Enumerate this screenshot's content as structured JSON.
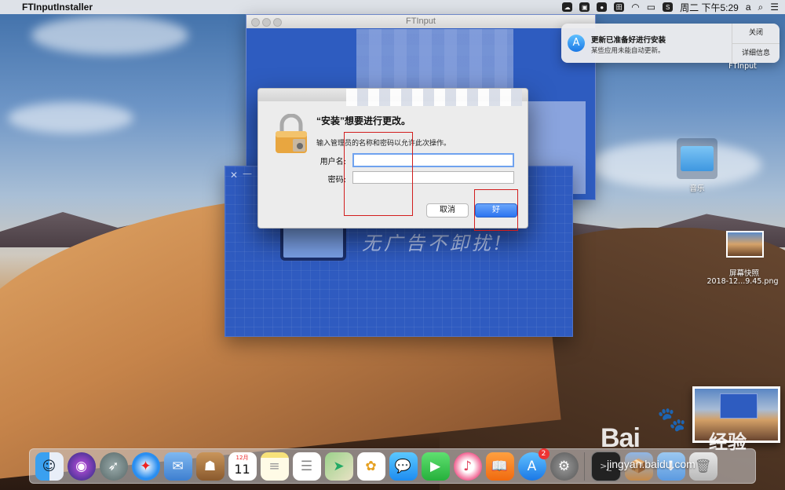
{
  "menubar": {
    "app_name": "FTInputInstaller",
    "clock": "周二 下午5:29",
    "input_source": "a"
  },
  "ftinput_window": {
    "title": "FTInput"
  },
  "blue_window": {
    "slogan": "无广告不卸扰!"
  },
  "auth_dialog": {
    "title": "“安装”想要进行更改。",
    "message": "输入管理员的名称和密码以允许此次操作。",
    "username_label": "用户名:",
    "username_value": "",
    "password_label": "密码:",
    "password_value": "",
    "cancel_label": "取消",
    "ok_label": "好"
  },
  "notification": {
    "title": "更新已准备好进行安装",
    "body": "某些应用未能自动更新。",
    "close_label": "关闭",
    "details_label": "详细信息"
  },
  "desktop": {
    "ftinput_label": "FTInput",
    "music_folder_label": "音乐",
    "screenshot_label_line1": "屏幕快照",
    "screenshot_label_line2": "2018-12...9.45.png"
  },
  "dock": {
    "calendar_month": "12月",
    "calendar_day": "11",
    "appstore_badge": "2",
    "items": [
      "finder",
      "siri",
      "launchpad",
      "safari",
      "mail",
      "contacts",
      "calendar",
      "notes",
      "reminders",
      "maps",
      "photos",
      "messages",
      "facetime",
      "itunes",
      "ibooks",
      "app-store",
      "system-preferences",
      "terminal",
      "installer",
      "downloads",
      "trash"
    ]
  },
  "watermark": {
    "brand": "Bai",
    "brand_suffix": "经验",
    "url": "jingyan.baidu.com"
  },
  "colors": {
    "accent_blue": "#2c74f0",
    "annotation_red": "#d21e1e",
    "window_blue": "#2e5cc0"
  }
}
